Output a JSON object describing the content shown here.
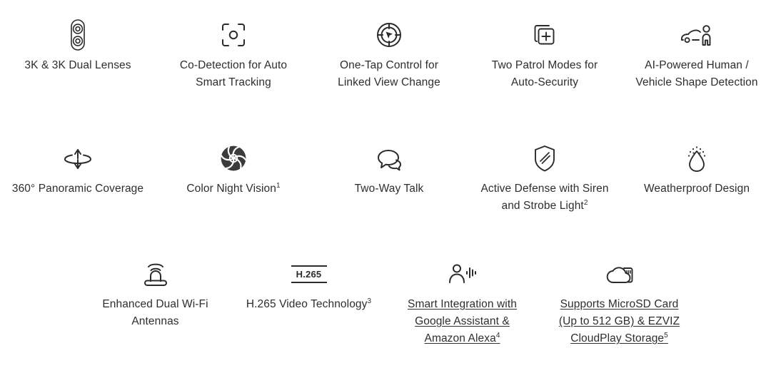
{
  "page": {
    "background": "#ffffff",
    "text_color": "#2e2e2e",
    "icon_color": "#2b2b2b"
  },
  "rows": [
    {
      "id": "row-1",
      "items": [
        {
          "icon": "dual-lens-icon",
          "label_line1": "3K & 3K Dual Lenses",
          "label_line2": "",
          "label_line3": "",
          "sup": "",
          "is_link": false
        },
        {
          "icon": "focus-frame-target-icon",
          "label_line1": "Co-Detection for Auto",
          "label_line2": "Smart Tracking",
          "label_line3": "",
          "sup": "",
          "is_link": false
        },
        {
          "icon": "crosshair-cursor-icon",
          "label_line1": "One-Tap Control for",
          "label_line2": "Linked View Change",
          "label_line3": "",
          "sup": "",
          "is_link": false
        },
        {
          "icon": "add-layers-icon",
          "label_line1": "Two Patrol Modes for",
          "label_line2": "Auto-Security",
          "label_line3": "",
          "sup": "",
          "is_link": false
        },
        {
          "icon": "car-person-detection-icon",
          "label_line1": "AI-Powered Human /",
          "label_line2": "Vehicle Shape Detection",
          "label_line3": "",
          "sup": "",
          "is_link": false
        }
      ]
    },
    {
      "id": "row-2",
      "items": [
        {
          "icon": "rotate-360-icon",
          "label_line1": "360° Panoramic Coverage",
          "label_line2": "",
          "label_line3": "",
          "sup": "",
          "is_link": false
        },
        {
          "icon": "aperture-icon",
          "label_line1": "Color Night Vision",
          "label_line2": "",
          "label_line3": "",
          "sup": "1",
          "is_link": false
        },
        {
          "icon": "speech-bubbles-icon",
          "label_line1": "Two-Way Talk",
          "label_line2": "",
          "label_line3": "",
          "sup": "",
          "is_link": false
        },
        {
          "icon": "shield-icon",
          "label_line1": "Active Defense with Siren",
          "label_line2": "and Strobe Light",
          "label_line3": "",
          "sup": "2",
          "is_link": false
        },
        {
          "icon": "water-drop-icon",
          "label_line1": "Weatherproof Design",
          "label_line2": "",
          "label_line3": "",
          "sup": "",
          "is_link": false
        }
      ]
    },
    {
      "id": "row-3",
      "items": [
        {
          "icon": "wifi-antenna-icon",
          "label_line1": "Enhanced Dual Wi-Fi",
          "label_line2": "Antennas",
          "label_line3": "",
          "sup": "",
          "is_link": false
        },
        {
          "icon": "h265-badge-icon",
          "icon_text": "H.265",
          "label_line1": "H.265 Video Technology",
          "label_line2": "",
          "label_line3": "",
          "sup": "3",
          "is_link": false
        },
        {
          "icon": "voice-assistant-icon",
          "label_line1": "Smart Integration with",
          "label_line2": "Google Assistant &",
          "label_line3": "Amazon Alexa",
          "sup": "4",
          "is_link": true
        },
        {
          "icon": "cloud-sdcard-icon",
          "label_line1": "Supports MicroSD Card",
          "label_line2": "(Up to 512 GB) & EZVIZ",
          "label_line3": "CloudPlay Storage",
          "sup": "5",
          "is_link": true
        }
      ]
    }
  ]
}
